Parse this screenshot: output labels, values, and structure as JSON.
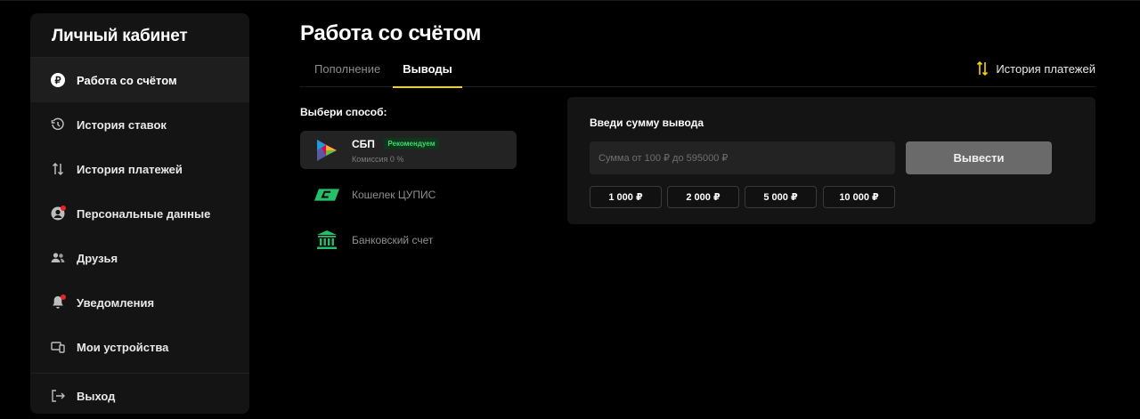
{
  "sidebar": {
    "title": "Личный кабинет",
    "items": [
      {
        "label": "Работа со счётом",
        "icon": "ruble-circle-icon"
      },
      {
        "label": "История ставок",
        "icon": "history-clock-icon"
      },
      {
        "label": "История платежей",
        "icon": "arrows-up-down-icon"
      },
      {
        "label": "Персональные данные",
        "icon": "user-profile-icon"
      },
      {
        "label": "Друзья",
        "icon": "friends-icon"
      },
      {
        "label": "Уведомления",
        "icon": "bell-icon"
      },
      {
        "label": "Мои устройства",
        "icon": "devices-icon"
      },
      {
        "label": "Выход",
        "icon": "logout-icon"
      }
    ]
  },
  "main": {
    "title": "Работа со счётом",
    "tabs": [
      "Пополнение",
      "Выводы"
    ],
    "active_tab": "Выводы",
    "history_link": "История платежей",
    "choose_label": "Выбери способ:",
    "methods": [
      {
        "name": "СБП",
        "badge": "Рекомендуем",
        "fee": "Комиссия 0 %",
        "icon": "sbp-logo-icon",
        "selected": true
      },
      {
        "name": "Кошелек ЦУПИС",
        "icon": "cupis-wallet-icon"
      },
      {
        "name": "Банковский счет",
        "icon": "bank-icon"
      }
    ]
  },
  "panel": {
    "title": "Введи сумму вывода",
    "input_placeholder": "Сумма от 100 ₽ до 595000 ₽",
    "button_label": "Вывести",
    "presets": [
      "1 000 ₽",
      "2 000 ₽",
      "5 000 ₽",
      "10 000 ₽"
    ]
  },
  "colors": {
    "accent": "#f2d400",
    "notify": "#e8242b",
    "badge_text": "#3fd86f",
    "bank_green": "#27c06a"
  }
}
